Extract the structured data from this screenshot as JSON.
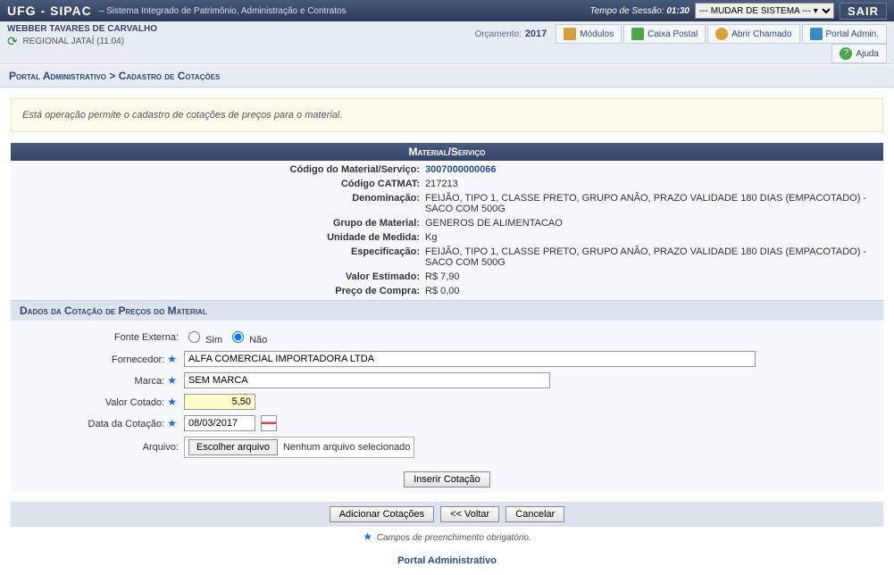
{
  "topbar": {
    "brand": "UFG - SIPAC",
    "subtitle": "– Sistema Integrado de Patrimônio, Administração e Contratos",
    "session_label": "Tempo de Sessão:",
    "session_time": "01:30",
    "system_select": "--- MUDAR DE SISTEMA --- ▾",
    "sair": "SAIR"
  },
  "userbar": {
    "username": "WEBBER TAVARES DE CARVALHO",
    "unit": "REGIONAL JATAÍ (11.04)",
    "orc_label": "Orçamento:",
    "orc_year": "2017",
    "nav": {
      "modulos": "Módulos",
      "caixa": "Caixa Postal",
      "chamado": "Abrir Chamado",
      "admin": "Portal Admin.",
      "ajuda": "Ajuda"
    }
  },
  "breadcrumb": {
    "a": "Portal Administrativo",
    "sep": ">",
    "b": "Cadastro de Cotações"
  },
  "info": "Está operação permite o cadastro de cotações de preços para o material.",
  "section1": "Material/Serviço",
  "material": {
    "codigo_lbl": "Código do Material/Serviço:",
    "codigo_val": "3007000000066",
    "catmat_lbl": "Código CATMAT:",
    "catmat_val": "217213",
    "denom_lbl": "Denominação:",
    "denom_val": "FEIJÃO, TIPO 1, CLASSE PRETO, GRUPO ANÃO, PRAZO VALIDADE 180 DIAS (EMPACOTADO) - SACO COM 500G",
    "grupo_lbl": "Grupo de Material:",
    "grupo_val": "GENEROS DE ALIMENTACAO",
    "unidade_lbl": "Unidade de Medida:",
    "unidade_val": "Kg",
    "espec_lbl": "Especificação:",
    "espec_val": "FEIJÃO, TIPO 1, CLASSE PRETO, GRUPO ANÃO, PRAZO VALIDADE 180 DIAS (EMPACOTADO) - SACO COM 500G",
    "valor_est_lbl": "Valor Estimado:",
    "valor_est_val": "R$ 7,90",
    "preco_lbl": "Preço de Compra:",
    "preco_val": "R$ 0,00"
  },
  "section2": "Dados da Cotação de Preços do Material",
  "form": {
    "fonte_lbl": "Fonte Externa:",
    "sim": "Sim",
    "nao": "Não",
    "fornecedor_lbl": "Fornecedor:",
    "fornecedor_val": "ALFA COMERCIAL IMPORTADORA LTDA",
    "marca_lbl": "Marca:",
    "marca_val": "SEM MARCA",
    "valor_lbl": "Valor Cotado:",
    "valor_val": "5,50",
    "data_lbl": "Data da Cotação:",
    "data_val": "08/03/2017",
    "arquivo_lbl": "Arquivo:",
    "escolher": "Escolher arquivo",
    "nenhum": "Nenhum arquivo selecionado",
    "inserir": "Inserir Cotação"
  },
  "actions": {
    "adicionar": "Adicionar Cotações",
    "voltar": "<< Voltar",
    "cancelar": "Cancelar"
  },
  "footnote": "Campos de preenchimento obrigatório.",
  "footer_link": "Portal Administrativo"
}
